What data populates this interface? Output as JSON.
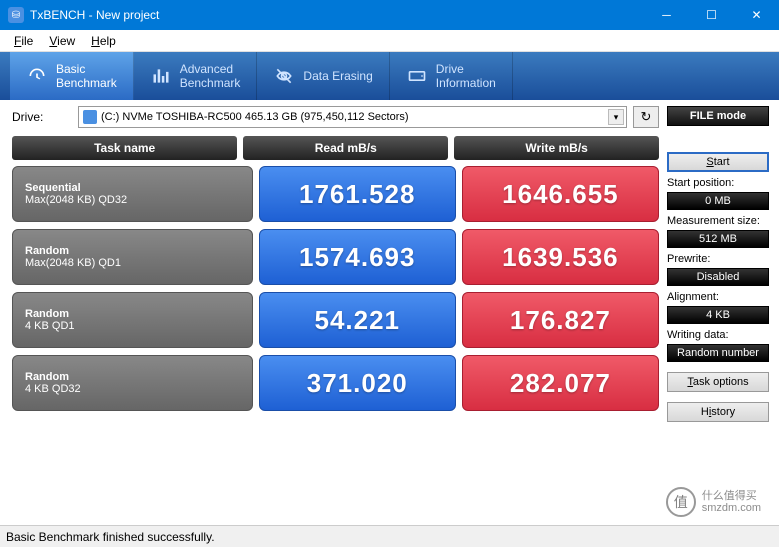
{
  "titlebar": {
    "app": "TxBENCH",
    "project": "New project"
  },
  "menu": {
    "file": "File",
    "view": "View",
    "help": "Help"
  },
  "tabs": [
    {
      "label": "Basic\nBenchmark"
    },
    {
      "label": "Advanced\nBenchmark"
    },
    {
      "label": "Data Erasing"
    },
    {
      "label": "Drive\nInformation"
    }
  ],
  "drive": {
    "label": "Drive:",
    "value": "(C:) NVMe TOSHIBA-RC500  465.13 GB (975,450,112 Sectors)"
  },
  "headers": {
    "task": "Task name",
    "read": "Read mB/s",
    "write": "Write mB/s"
  },
  "rows": [
    {
      "t1": "Sequential",
      "t2": "Max(2048 KB) QD32",
      "read": "1761.528",
      "write": "1646.655"
    },
    {
      "t1": "Random",
      "t2": "Max(2048 KB) QD1",
      "read": "1574.693",
      "write": "1639.536"
    },
    {
      "t1": "Random",
      "t2": "4 KB QD1",
      "read": "54.221",
      "write": "176.827"
    },
    {
      "t1": "Random",
      "t2": "4 KB QD32",
      "read": "371.020",
      "write": "282.077"
    }
  ],
  "side": {
    "file_mode": "FILE mode",
    "start": "Start",
    "start_pos_lbl": "Start position:",
    "start_pos_val": "0 MB",
    "meas_lbl": "Measurement size:",
    "meas_val": "512 MB",
    "prewrite_lbl": "Prewrite:",
    "prewrite_val": "Disabled",
    "align_lbl": "Alignment:",
    "align_val": "4 KB",
    "wdata_lbl": "Writing data:",
    "wdata_val": "Random number",
    "task_opt": "Task options",
    "history": "History"
  },
  "status": "Basic Benchmark finished successfully.",
  "watermark": {
    "icon": "值",
    "line1": "什么值得买",
    "line2": "smzdm.com"
  },
  "chart_data": {
    "type": "table",
    "columns": [
      "Task name",
      "Read mB/s",
      "Write mB/s"
    ],
    "rows": [
      [
        "Sequential Max(2048 KB) QD32",
        1761.528,
        1646.655
      ],
      [
        "Random Max(2048 KB) QD1",
        1574.693,
        1639.536
      ],
      [
        "Random 4 KB QD1",
        54.221,
        176.827
      ],
      [
        "Random 4 KB QD32",
        371.02,
        282.077
      ]
    ]
  }
}
